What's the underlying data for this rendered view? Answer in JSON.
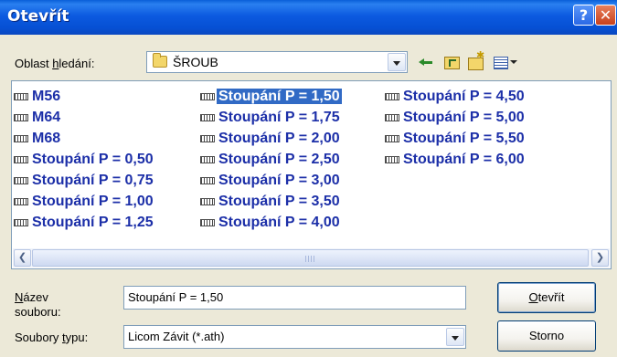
{
  "window": {
    "title": "Otevřít",
    "help_label": "?",
    "close_label": "✕"
  },
  "lookin": {
    "label_pre": "Oblast ",
    "label_accel": "h",
    "label_post": "ledání:",
    "value": "ŠROUB"
  },
  "toolbar": {
    "icons": [
      "back-icon",
      "up-folder-icon",
      "new-folder-icon",
      "views-menu-icon"
    ]
  },
  "files": {
    "col1": [
      "M56",
      "M64",
      "M68",
      "Stoupání P = 0,50",
      "Stoupání P = 0,75",
      "Stoupání P = 1,00",
      "Stoupání P = 1,25"
    ],
    "col2": [
      "Stoupání P = 1,50",
      "Stoupání P = 1,75",
      "Stoupání P = 2,00",
      "Stoupání P = 2,50",
      "Stoupání P = 3,00",
      "Stoupání P = 3,50",
      "Stoupání P = 4,00"
    ],
    "col3": [
      "Stoupání P = 4,50",
      "Stoupání P = 5,00",
      "Stoupání P = 5,50",
      "Stoupání P = 6,00"
    ],
    "selected": "Stoupání P = 1,50"
  },
  "filename": {
    "label_accel": "N",
    "label_line1_post": "ázev",
    "label_line2": "souboru:",
    "value": "Stoupání P = 1,50"
  },
  "filetype": {
    "label_pre": "Soubory ",
    "label_accel": "t",
    "label_post": "ypu:",
    "value": "Licom Závit (*.ath)"
  },
  "buttons": {
    "open_accel": "O",
    "open_rest": "tevřít",
    "cancel": "Storno"
  },
  "colors": {
    "titlebar": "#0650d4",
    "file_text": "#1c2fa8",
    "selection": "#316ac5",
    "dialog_bg": "#ece9d8"
  }
}
